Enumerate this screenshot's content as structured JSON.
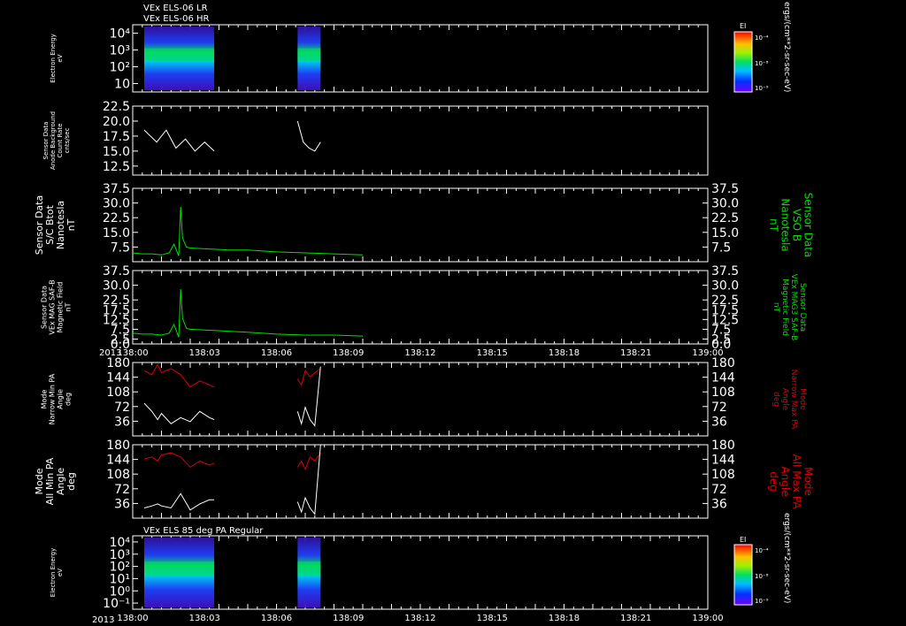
{
  "chart_data": {
    "type": "line",
    "header_lines": [
      "VEx ELS-06 LR",
      "VEx ELS-06 HR"
    ],
    "year": "2013",
    "x_ticks": [
      "138:00",
      "138:03",
      "138:06",
      "138:09",
      "138:12",
      "138:15",
      "138:18",
      "138:21",
      "139:00"
    ],
    "time_range": [
      "138:00",
      "139:00"
    ],
    "colors": {
      "green": "#00e000",
      "red": "#e00000",
      "white": "#ffffff"
    },
    "panels": [
      {
        "id": "els-energy-1",
        "type": "heatmap",
        "ylabel": [
          "Electron Energy",
          "eV"
        ],
        "y_ticks": [
          "10",
          "10²",
          "10³",
          "10⁴"
        ],
        "colorbar": {
          "title": "EI",
          "ticks": [
            "10⁻⁴",
            "10⁻⁸",
            "10⁻⁹"
          ],
          "units": "ergs/(cm**2-sr-sec-eV)"
        },
        "data_intervals_min": [
          [
            1.2,
            8.5
          ],
          [
            17.2,
            19.6
          ]
        ]
      },
      {
        "id": "anode-background",
        "type": "line",
        "ylabel": [
          "Sensor Data",
          "Anode Background",
          "Count Rate",
          "cnts/sec"
        ],
        "y_ticks": [
          12.5,
          15.0,
          17.5,
          20.0,
          22.5
        ],
        "ylim": [
          11,
          22.5
        ],
        "series": [
          {
            "color": "white",
            "segments": [
              {
                "x": [
                  1.2,
                  2.5,
                  3.5,
                  4.5,
                  5.5,
                  6.5,
                  7.5,
                  8.5
                ],
                "y": [
                  18.5,
                  16.5,
                  18.5,
                  15.5,
                  17.0,
                  15.0,
                  16.5,
                  15.0
                ]
              },
              {
                "x": [
                  17.2,
                  17.8,
                  18.4,
                  19.0,
                  19.6
                ],
                "y": [
                  20.0,
                  16.5,
                  15.5,
                  15.0,
                  16.5
                ]
              }
            ]
          }
        ]
      },
      {
        "id": "sc-bmag",
        "type": "line",
        "ylabel": [
          "Sensor Data",
          "S/C Btot",
          "Nanotesla",
          "nT"
        ],
        "y2label": [
          "Sensor Data",
          "VSO B",
          "Nanotesla",
          "nT"
        ],
        "y_ticks": [
          7.5,
          15.0,
          22.5,
          30.0,
          37.5
        ],
        "ylim": [
          0,
          37.5
        ],
        "series": [
          {
            "color": "green",
            "segments": [
              {
                "x": [
                  0,
                  1,
                  2,
                  3,
                  3.8,
                  4.3,
                  4.8,
                  5.0,
                  5.2,
                  5.6,
                  6,
                  8,
                  10,
                  12,
                  15,
                  18,
                  21,
                  24
                ],
                "y": [
                  4.5,
                  4.0,
                  4.0,
                  3.5,
                  4.5,
                  9.0,
                  3.0,
                  28.0,
                  12.0,
                  7.5,
                  7.0,
                  6.5,
                  6.0,
                  6.0,
                  5.0,
                  4.5,
                  4.0,
                  3.5
                ]
              }
            ]
          }
        ]
      },
      {
        "id": "mag3-saf-b",
        "type": "line",
        "ylabel": [
          "Sensor Data",
          "VEx MAG SAF-B",
          "Magnetic Field",
          "nT"
        ],
        "y2label": [
          "Sensor Data",
          "VEx MAG3 SAF-B",
          "Magnetic Field",
          "nT"
        ],
        "y_ticks": [
          0.0,
          2.5,
          7.5,
          12.5,
          17.5,
          22.5,
          30.0,
          37.5
        ],
        "ylim": [
          0,
          37.5
        ],
        "series": [
          {
            "color": "green",
            "segments": [
              {
                "x": [
                  0,
                  1,
                  2,
                  3,
                  3.8,
                  4.3,
                  4.8,
                  5.0,
                  5.2,
                  5.6,
                  6,
                  8,
                  10,
                  12,
                  15,
                  18,
                  21,
                  24
                ],
                "y": [
                  5.5,
                  5.0,
                  5.0,
                  4.5,
                  5.5,
                  10.0,
                  3.5,
                  28.0,
                  13.0,
                  8.0,
                  7.5,
                  7.0,
                  6.5,
                  6.0,
                  5.0,
                  4.5,
                  4.5,
                  4.0
                ]
              }
            ]
          }
        ]
      },
      {
        "id": "narrow-pa",
        "type": "line",
        "ylabel": [
          "Mode",
          "Narrow Min PA",
          "Angle",
          "deg"
        ],
        "y2label": [
          "Mode",
          "Narrow Max PA",
          "Angle",
          "deg"
        ],
        "y_ticks": [
          36,
          72,
          108,
          144,
          180
        ],
        "ylim": [
          0,
          180
        ],
        "series": [
          {
            "color": "red",
            "segments": [
              {
                "x": [
                  1.2,
                  2.0,
                  2.6,
                  3.0,
                  4.0,
                  5.0,
                  6.0,
                  7.0,
                  8.0,
                  8.5
                ],
                "y": [
                  160,
                  150,
                  175,
                  155,
                  165,
                  150,
                  120,
                  135,
                  125,
                  120
                ]
              },
              {
                "x": [
                  17.2,
                  17.6,
                  18.0,
                  18.5,
                  19.0,
                  19.6
                ],
                "y": [
                  140,
                  125,
                  160,
                  145,
                  155,
                  165
                ]
              }
            ]
          },
          {
            "color": "white",
            "segments": [
              {
                "x": [
                  1.2,
                  2.0,
                  2.6,
                  3.0,
                  4.0,
                  5.0,
                  6.0,
                  7.0,
                  8.0,
                  8.5
                ],
                "y": [
                  80,
                  60,
                  40,
                  55,
                  30,
                  45,
                  35,
                  60,
                  45,
                  40
                ]
              },
              {
                "x": [
                  17.2,
                  17.6,
                  18.0,
                  18.5,
                  19.0,
                  19.6
                ],
                "y": [
                  60,
                  30,
                  70,
                  40,
                  25,
                  170
                ]
              }
            ]
          }
        ]
      },
      {
        "id": "all-pa",
        "type": "line",
        "ylabel": [
          "Mode",
          "All Min PA",
          "Angle",
          "deg"
        ],
        "y2label": [
          "Mode",
          "All Max PA",
          "Angle",
          "deg"
        ],
        "y_ticks": [
          36,
          72,
          108,
          144,
          180
        ],
        "ylim": [
          0,
          180
        ],
        "series": [
          {
            "color": "red",
            "segments": [
              {
                "x": [
                  1.2,
                  2.0,
                  2.6,
                  3.0,
                  4.0,
                  5.0,
                  6.0,
                  7.0,
                  8.0,
                  8.5
                ],
                "y": [
                  145,
                  150,
                  140,
                  155,
                  160,
                  150,
                  125,
                  140,
                  130,
                  135
                ]
              },
              {
                "x": [
                  17.2,
                  17.6,
                  18.0,
                  18.5,
                  19.0,
                  19.6
                ],
                "y": [
                  125,
                  140,
                  120,
                  150,
                  140,
                  160
                ]
              }
            ]
          },
          {
            "color": "white",
            "segments": [
              {
                "x": [
                  1.2,
                  2.0,
                  2.6,
                  3.0,
                  4.0,
                  5.0,
                  6.0,
                  7.0,
                  8.0,
                  8.5
                ],
                "y": [
                  25,
                  30,
                  35,
                  30,
                  25,
                  60,
                  20,
                  35,
                  45,
                  45
                ]
              },
              {
                "x": [
                  17.2,
                  17.6,
                  18.0,
                  18.5,
                  19.0,
                  19.6
                ],
                "y": [
                  40,
                  15,
                  50,
                  25,
                  10,
                  180
                ]
              }
            ]
          }
        ]
      },
      {
        "id": "els-energy-85",
        "type": "heatmap",
        "title": "VEx ELS 85 deg PA Regular",
        "ylabel": [
          "Electron Energy",
          "eV"
        ],
        "y_ticks": [
          "10⁻¹",
          "10⁰",
          "10¹",
          "10²",
          "10³",
          "10⁴"
        ],
        "colorbar": {
          "title": "EI",
          "ticks": [
            "10⁻⁴",
            "10⁻⁸",
            "10⁻⁹"
          ],
          "units": "ergs/(cm**2-sr-sec-eV)"
        },
        "data_intervals_min": [
          [
            1.2,
            8.5
          ],
          [
            17.2,
            19.6
          ]
        ]
      }
    ]
  }
}
